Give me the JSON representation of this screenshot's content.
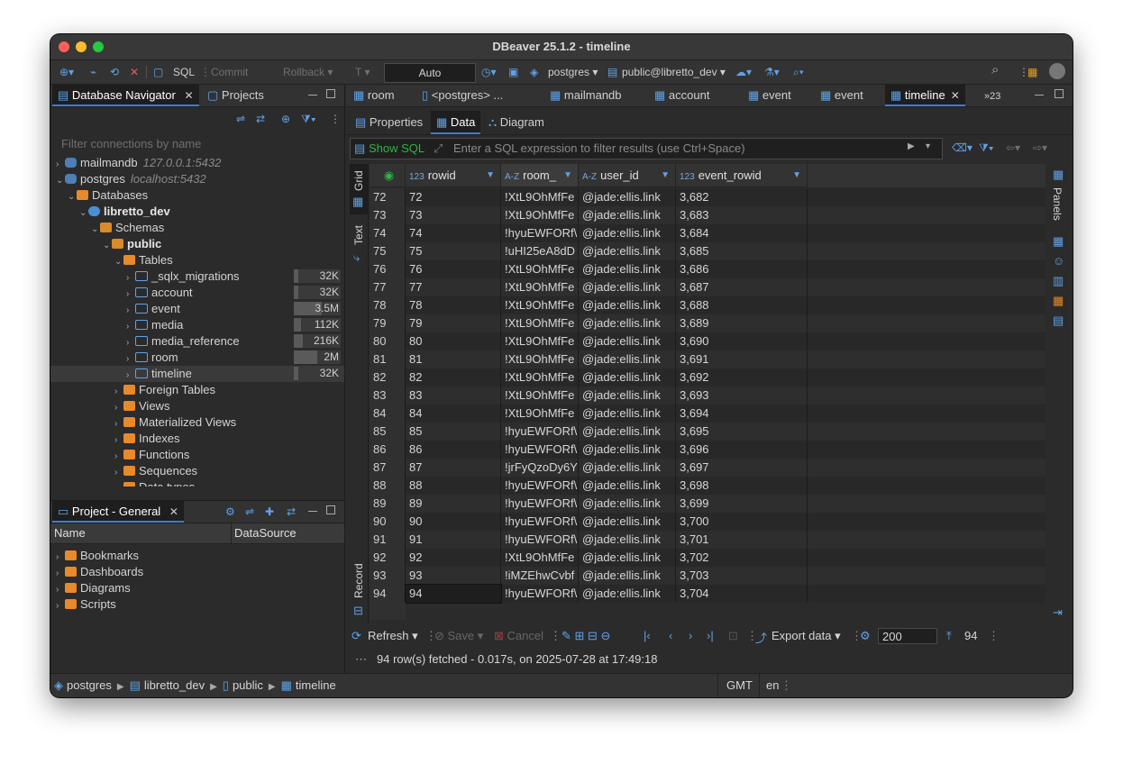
{
  "window": {
    "title": "DBeaver 25.1.2 - timeline"
  },
  "toolbar": {
    "sql_label": "SQL",
    "commit_label": "Commit",
    "rollback_label": "Rollback",
    "txn_mode": "Auto",
    "connection": "postgres",
    "schema": "public@libretto_dev"
  },
  "navigator": {
    "tab_label": "Database Navigator",
    "projects_tab": "Projects",
    "filter_placeholder": "Filter connections by name",
    "tree": [
      {
        "label": "mailmandb",
        "host": "127.0.0.1:5432",
        "indent": 0,
        "arrow": ">",
        "icon": "pg"
      },
      {
        "label": "postgres",
        "host": "localhost:5432",
        "indent": 0,
        "arrow": "v",
        "icon": "pg"
      },
      {
        "label": "Databases",
        "indent": 1,
        "arrow": "v",
        "icon": "folder"
      },
      {
        "label": "libretto_dev",
        "indent": 2,
        "arrow": "v",
        "icon": "db",
        "bold": true
      },
      {
        "label": "Schemas",
        "indent": 3,
        "arrow": "v",
        "icon": "schema"
      },
      {
        "label": "public",
        "indent": 4,
        "arrow": "v",
        "icon": "schema",
        "bold": true
      },
      {
        "label": "Tables",
        "indent": 5,
        "arrow": "v",
        "icon": "folder"
      },
      {
        "label": "_sqlx_migrations",
        "indent": 6,
        "arrow": ">",
        "icon": "table",
        "size": "32K",
        "fill": 0.1
      },
      {
        "label": "account",
        "indent": 6,
        "arrow": ">",
        "icon": "table",
        "size": "32K",
        "fill": 0.1
      },
      {
        "label": "event",
        "indent": 6,
        "arrow": ">",
        "icon": "table",
        "size": "3.5M",
        "fill": 0.6
      },
      {
        "label": "media",
        "indent": 6,
        "arrow": ">",
        "icon": "table",
        "size": "112K",
        "fill": 0.15
      },
      {
        "label": "media_reference",
        "indent": 6,
        "arrow": ">",
        "icon": "table",
        "size": "216K",
        "fill": 0.2
      },
      {
        "label": "room",
        "indent": 6,
        "arrow": ">",
        "icon": "table",
        "size": "2M",
        "fill": 0.5
      },
      {
        "label": "timeline",
        "indent": 6,
        "arrow": ">",
        "icon": "table",
        "size": "32K",
        "fill": 0.1,
        "selected": true
      },
      {
        "label": "Foreign Tables",
        "indent": 5,
        "arrow": ">",
        "icon": "folder"
      },
      {
        "label": "Views",
        "indent": 5,
        "arrow": ">",
        "icon": "folder"
      },
      {
        "label": "Materialized Views",
        "indent": 5,
        "arrow": ">",
        "icon": "folder"
      },
      {
        "label": "Indexes",
        "indent": 5,
        "arrow": ">",
        "icon": "folder"
      },
      {
        "label": "Functions",
        "indent": 5,
        "arrow": ">",
        "icon": "folder"
      },
      {
        "label": "Sequences",
        "indent": 5,
        "arrow": ">",
        "icon": "folder"
      },
      {
        "label": "Data types",
        "indent": 5,
        "arrow": ">",
        "icon": "folder"
      }
    ]
  },
  "project": {
    "tab_label": "Project - General",
    "col_name": "Name",
    "col_datasource": "DataSource",
    "items": [
      "Bookmarks",
      "Dashboards",
      "Diagrams",
      "Scripts"
    ]
  },
  "editor": {
    "tabs": [
      "room",
      "<postgres> ...",
      "mailmandb",
      "account",
      "event",
      "event",
      "timeline"
    ],
    "overflow": "23",
    "subtabs": [
      "Properties",
      "Data",
      "Diagram"
    ],
    "show_sql": "Show SQL",
    "filter_placeholder": "Enter a SQL expression to filter results (use Ctrl+Space)",
    "side_tabs": [
      "Grid",
      "Text",
      "Record"
    ],
    "panels_label": "Panels",
    "columns": [
      {
        "type": "123",
        "name": "rowid"
      },
      {
        "type": "A-Z",
        "name": "room_"
      },
      {
        "type": "A-Z",
        "name": "user_id"
      },
      {
        "type": "123",
        "name": "event_rowid"
      }
    ],
    "rows": [
      [
        "72",
        "72",
        "!XtL9OhMfFe",
        "@jade:ellis.link",
        "3,682"
      ],
      [
        "73",
        "73",
        "!XtL9OhMfFe",
        "@jade:ellis.link",
        "3,683"
      ],
      [
        "74",
        "74",
        "!hyuEWFORf\\",
        "@jade:ellis.link",
        "3,684"
      ],
      [
        "75",
        "75",
        "!uHI25eA8dD",
        "@jade:ellis.link",
        "3,685"
      ],
      [
        "76",
        "76",
        "!XtL9OhMfFe",
        "@jade:ellis.link",
        "3,686"
      ],
      [
        "77",
        "77",
        "!XtL9OhMfFe",
        "@jade:ellis.link",
        "3,687"
      ],
      [
        "78",
        "78",
        "!XtL9OhMfFe",
        "@jade:ellis.link",
        "3,688"
      ],
      [
        "79",
        "79",
        "!XtL9OhMfFe",
        "@jade:ellis.link",
        "3,689"
      ],
      [
        "80",
        "80",
        "!XtL9OhMfFe",
        "@jade:ellis.link",
        "3,690"
      ],
      [
        "81",
        "81",
        "!XtL9OhMfFe",
        "@jade:ellis.link",
        "3,691"
      ],
      [
        "82",
        "82",
        "!XtL9OhMfFe",
        "@jade:ellis.link",
        "3,692"
      ],
      [
        "83",
        "83",
        "!XtL9OhMfFe",
        "@jade:ellis.link",
        "3,693"
      ],
      [
        "84",
        "84",
        "!XtL9OhMfFe",
        "@jade:ellis.link",
        "3,694"
      ],
      [
        "85",
        "85",
        "!hyuEWFORf\\",
        "@jade:ellis.link",
        "3,695"
      ],
      [
        "86",
        "86",
        "!hyuEWFORf\\",
        "@jade:ellis.link",
        "3,696"
      ],
      [
        "87",
        "87",
        "!jrFyQzoDy6Y",
        "@jade:ellis.link",
        "3,697"
      ],
      [
        "88",
        "88",
        "!hyuEWFORf\\",
        "@jade:ellis.link",
        "3,698"
      ],
      [
        "89",
        "89",
        "!hyuEWFORf\\",
        "@jade:ellis.link",
        "3,699"
      ],
      [
        "90",
        "90",
        "!hyuEWFORf\\",
        "@jade:ellis.link",
        "3,700"
      ],
      [
        "91",
        "91",
        "!hyuEWFORf\\",
        "@jade:ellis.link",
        "3,701"
      ],
      [
        "92",
        "92",
        "!XtL9OhMfFe",
        "@jade:ellis.link",
        "3,702"
      ],
      [
        "93",
        "93",
        "!iMZEhwCvbf",
        "@jade:ellis.link",
        "3,703"
      ],
      [
        "94",
        "94",
        "!hyuEWFORf\\",
        "@jade:ellis.link",
        "3,704"
      ]
    ],
    "bottom": {
      "refresh": "Refresh",
      "save": "Save",
      "cancel": "Cancel",
      "export": "Export data",
      "fetch_size": "200",
      "row_count": "94",
      "status": "94 row(s) fetched - 0.017s, on 2025-07-28 at 17:49:18"
    }
  },
  "statusbar": {
    "crumbs": [
      "postgres",
      "libretto_dev",
      "public",
      "timeline"
    ],
    "timezone": "GMT",
    "locale": "en"
  },
  "colors": {
    "accent": "#3d7bd6",
    "folder": "#e8892b",
    "table": "#5fa3e8",
    "background": "#2b2b2b"
  }
}
